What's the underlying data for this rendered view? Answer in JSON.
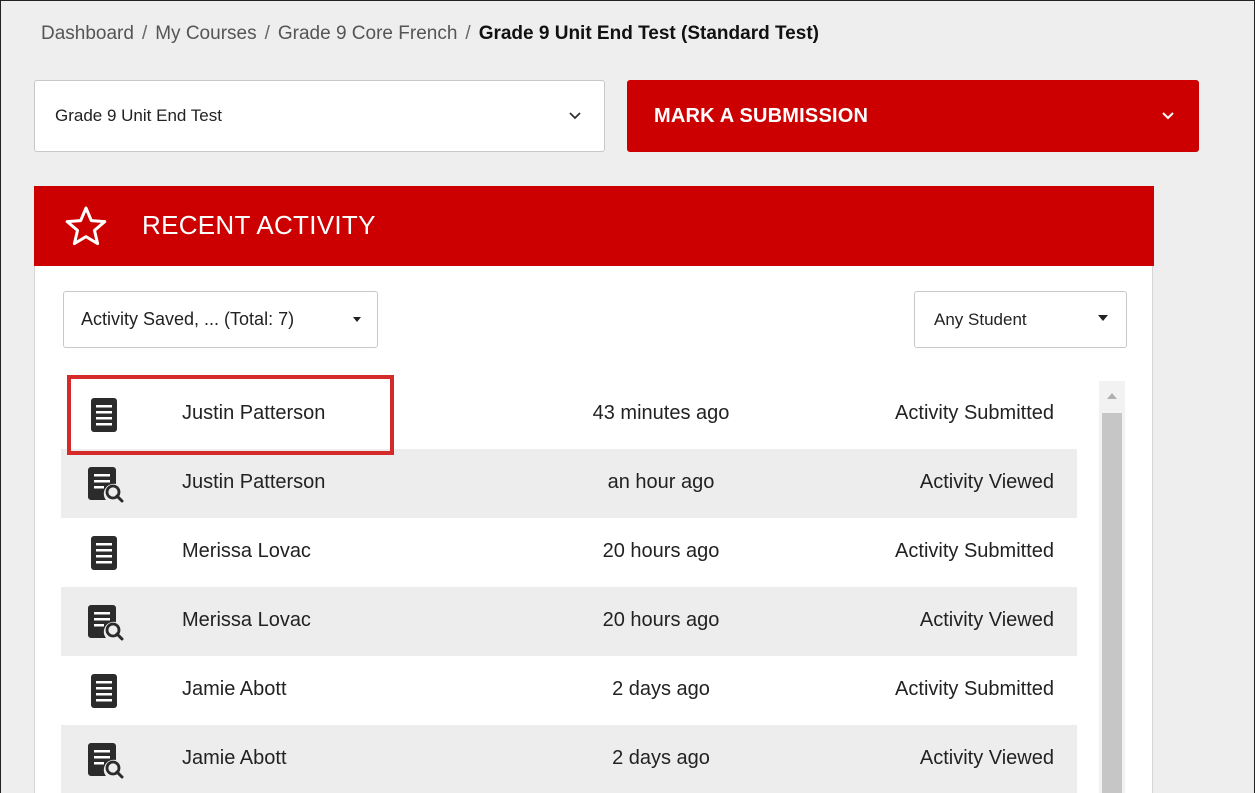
{
  "breadcrumb": {
    "items": [
      "Dashboard",
      "My Courses",
      "Grade 9 Core French"
    ],
    "current": "Grade 9 Unit End Test (Standard Test)",
    "separator": "/"
  },
  "test_select": {
    "value": "Grade 9 Unit End Test"
  },
  "mark_button": {
    "label": "MARK A SUBMISSION"
  },
  "panel": {
    "title": "RECENT ACTIVITY",
    "filter": {
      "value": "Activity Saved, ... (Total: 7)"
    },
    "student_filter": {
      "value": "Any Student"
    },
    "rows": [
      {
        "icon": "document-icon",
        "name": "Justin Patterson",
        "time": "43 minutes ago",
        "status": "Activity Submitted"
      },
      {
        "icon": "document-search-icon",
        "name": "Justin Patterson",
        "time": "an hour ago",
        "status": "Activity Viewed"
      },
      {
        "icon": "document-icon",
        "name": "Merissa Lovac",
        "time": "20 hours ago",
        "status": "Activity Submitted"
      },
      {
        "icon": "document-search-icon",
        "name": "Merissa Lovac",
        "time": "20 hours ago",
        "status": "Activity Viewed"
      },
      {
        "icon": "document-icon",
        "name": "Jamie Abott",
        "time": "2 days ago",
        "status": "Activity Submitted"
      },
      {
        "icon": "document-search-icon",
        "name": "Jamie Abott",
        "time": "2 days ago",
        "status": "Activity Viewed"
      }
    ]
  },
  "colors": {
    "brand_red": "#cc0000",
    "highlight": "#d42a2a",
    "alt_row": "#ededed"
  }
}
